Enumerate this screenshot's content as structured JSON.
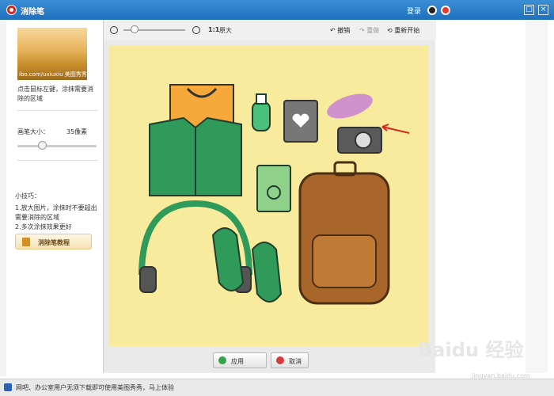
{
  "window": {
    "title": "消除笔",
    "login_label": "登录",
    "maximize_label": "□",
    "close_label": "×"
  },
  "left_panel": {
    "thumb_watermark": "ibo.com/uxiuxiu 美图秀秀",
    "hint": "点击鼠标左键，涂抹需要消除的区域",
    "brush_size_label": "画笔大小：",
    "brush_size_value": "35像素",
    "tips_title": "小技巧：",
    "tips": [
      "1.放大图片，涂抹时不要超出需要消除的区域",
      "2.多次涂抹效果更好"
    ],
    "tutorial_button": "消除笔教程"
  },
  "toolbar": {
    "zoom_ratio": "1:1",
    "zoom_original": "原大",
    "undo": "撤销",
    "redo": "重做",
    "reset": "重新开始"
  },
  "footer_buttons": {
    "apply": "应用",
    "cancel": "取消"
  },
  "status_bar": {
    "text": "网吧、办公室用户无须下载即可使用美图秀秀，马上体验"
  },
  "watermark": {
    "logo": "Baidu 经验",
    "url": "jingyan.baidu.com"
  },
  "colors": {
    "titlebar": "#2b7fd0",
    "canvas_bg": "#f8eb9d",
    "accent_red": "#d9231c"
  }
}
